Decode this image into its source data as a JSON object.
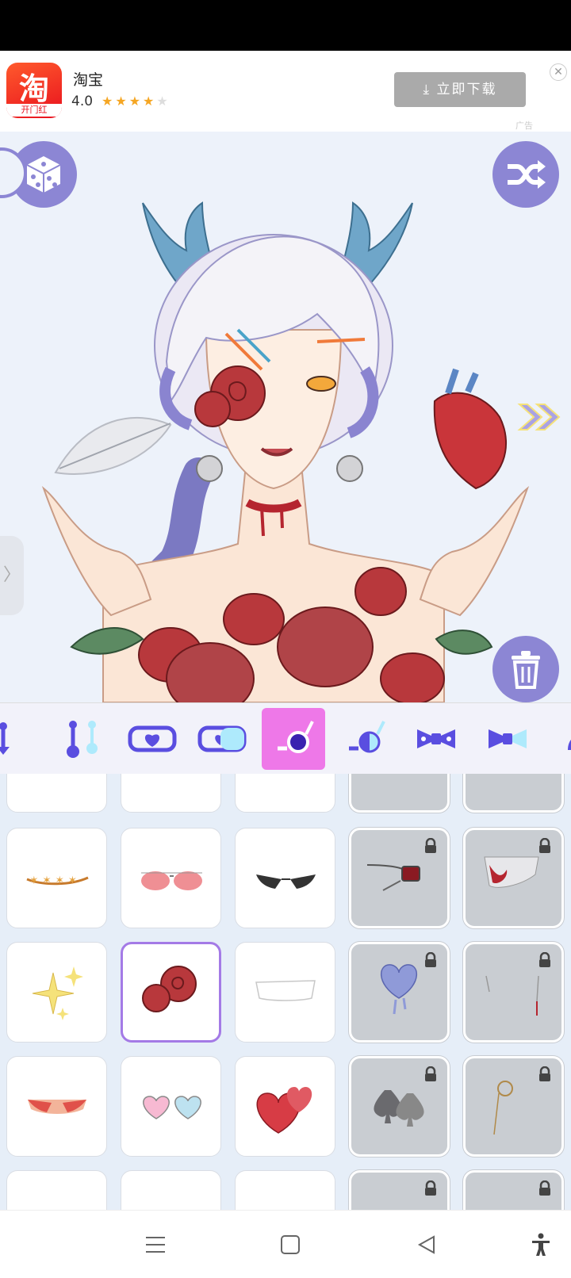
{
  "ad": {
    "app_name": "淘宝",
    "rating": "4.0",
    "stars_filled": 4,
    "stars_total": 5,
    "logo_glyph": "淘",
    "logo_sub": "开门红",
    "download_label": "立即下载",
    "tag": "广告"
  },
  "canvas": {
    "buttons": [
      "dice-icon",
      "shuffle-icon",
      "trash-icon",
      "next-icon"
    ]
  },
  "tabs": [
    {
      "name": "earring-partial",
      "icon": "earring-icon"
    },
    {
      "name": "earring-right",
      "icon": "earring-icon"
    },
    {
      "name": "eye-mask",
      "icon": "mask-icon"
    },
    {
      "name": "eye-mask-right",
      "icon": "mask-icon"
    },
    {
      "name": "face-accessory",
      "icon": "monocle-icon",
      "active": true
    },
    {
      "name": "face-accessory-right",
      "icon": "monocle-icon"
    },
    {
      "name": "bow",
      "icon": "bow-icon"
    },
    {
      "name": "bow-right",
      "icon": "bow-icon"
    },
    {
      "name": "hat",
      "icon": "hat-icon"
    }
  ],
  "items": [
    {
      "name": "star-chain",
      "locked": false
    },
    {
      "name": "pink-aviator-glasses",
      "locked": false
    },
    {
      "name": "cat-eye-sunglasses",
      "locked": false
    },
    {
      "name": "choker-gem",
      "locked": true
    },
    {
      "name": "blood-bandage",
      "locked": true
    },
    {
      "name": "sparkles",
      "locked": false
    },
    {
      "name": "roses",
      "locked": false,
      "selected": true
    },
    {
      "name": "white-bandage",
      "locked": false
    },
    {
      "name": "crying-heart",
      "locked": true
    },
    {
      "name": "nose-chain",
      "locked": true
    },
    {
      "name": "blush-band",
      "locked": false
    },
    {
      "name": "heart-glasses",
      "locked": false
    },
    {
      "name": "red-hearts",
      "locked": false
    },
    {
      "name": "spades",
      "locked": true
    },
    {
      "name": "monocle",
      "locked": true
    }
  ],
  "nav": [
    "menu-icon",
    "home-icon",
    "back-icon",
    "accessibility-icon"
  ]
}
